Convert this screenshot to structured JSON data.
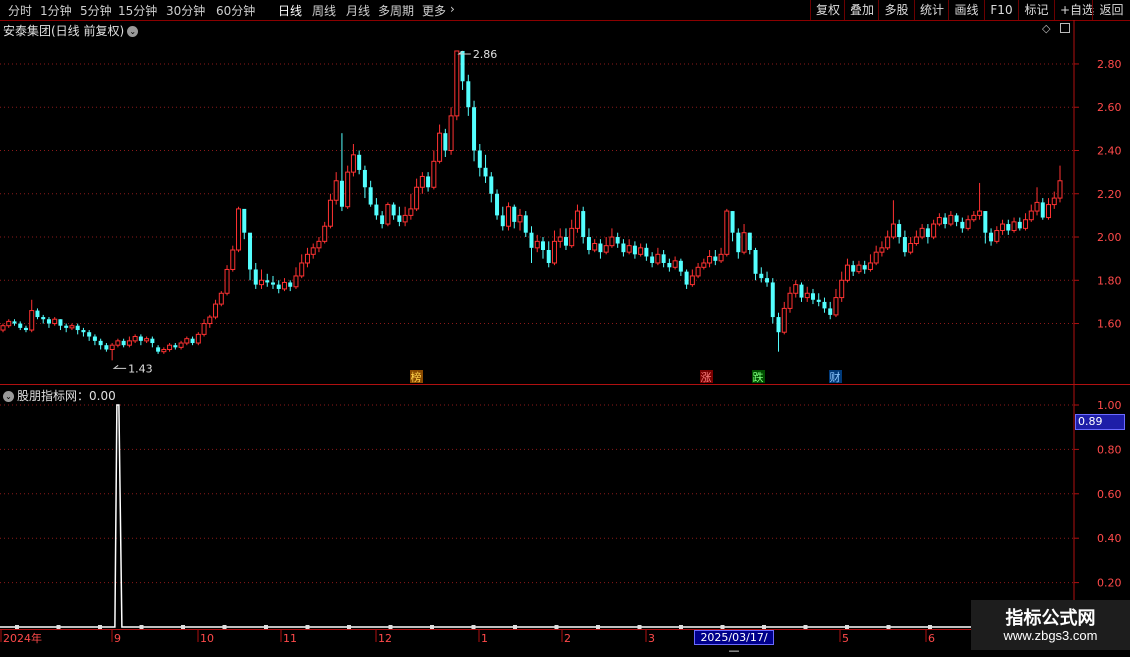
{
  "toolbar": {
    "periods": [
      "分时",
      "1分钟",
      "5分钟",
      "15分钟",
      "30分钟",
      "60分钟",
      "日线",
      "周线",
      "月线",
      "多周期",
      "更多"
    ],
    "active_period": "日线",
    "right_buttons": [
      "复权",
      "叠加",
      "多股",
      "统计",
      "画线",
      "F10",
      "标记",
      "+自选",
      "返回"
    ]
  },
  "main_panel": {
    "title": "安泰集团(日线 前复权)",
    "price_axis_ticks": [
      "2.80",
      "2.60",
      "2.40",
      "2.20",
      "2.00",
      "1.80",
      "1.60"
    ],
    "high_label": "2.86",
    "low_label": "1.43",
    "event_markers": [
      {
        "text": "榜",
        "bg": "#8a4a00",
        "fg": "#ffd24a"
      },
      {
        "text": "涨",
        "bg": "#7a0000",
        "fg": "#ff8080"
      },
      {
        "text": "跌",
        "bg": "#005000",
        "fg": "#7cff7c"
      },
      {
        "text": "财",
        "bg": "#003a7a",
        "fg": "#8ec8ff"
      }
    ]
  },
  "indicator_panel": {
    "title": "股朋指标网：0.00",
    "axis_ticks": [
      "1.00",
      "0.80",
      "0.60",
      "0.40",
      "0.20"
    ],
    "current_value": "0.89"
  },
  "time_axis": {
    "labels": [
      "2024年",
      "9",
      "10",
      "11",
      "12",
      "1",
      "2",
      "3",
      "5",
      "6"
    ],
    "cursor_date": "2025/03/17/—"
  },
  "watermark": {
    "line1": "指标公式网",
    "line2": "www.zbgs3.com"
  },
  "colors": {
    "up": "#ff3232",
    "down": "#54ffff",
    "grid": "#8b1a1a",
    "frame": "#b01010",
    "indicator_line": "#ffffff"
  },
  "chart_data": {
    "type": "candlestick",
    "ylim": [
      1.45,
      2.92
    ],
    "candles": [
      [
        1.57,
        1.59,
        1.56,
        1.6
      ],
      [
        1.59,
        1.61,
        1.58,
        1.62
      ],
      [
        1.61,
        1.6,
        1.59,
        1.62
      ],
      [
        1.6,
        1.58,
        1.57,
        1.61
      ],
      [
        1.58,
        1.57,
        1.56,
        1.59
      ],
      [
        1.57,
        1.66,
        1.56,
        1.71
      ],
      [
        1.66,
        1.63,
        1.62,
        1.67
      ],
      [
        1.63,
        1.62,
        1.6,
        1.64
      ],
      [
        1.62,
        1.6,
        1.58,
        1.63
      ],
      [
        1.6,
        1.62,
        1.59,
        1.63
      ],
      [
        1.62,
        1.59,
        1.57,
        1.62
      ],
      [
        1.59,
        1.58,
        1.56,
        1.6
      ],
      [
        1.58,
        1.59,
        1.57,
        1.6
      ],
      [
        1.59,
        1.57,
        1.55,
        1.6
      ],
      [
        1.57,
        1.56,
        1.54,
        1.58
      ],
      [
        1.56,
        1.54,
        1.52,
        1.57
      ],
      [
        1.54,
        1.52,
        1.5,
        1.55
      ],
      [
        1.52,
        1.5,
        1.48,
        1.53
      ],
      [
        1.5,
        1.48,
        1.47,
        1.51
      ],
      [
        1.48,
        1.5,
        1.43,
        1.51
      ],
      [
        1.5,
        1.52,
        1.49,
        1.53
      ],
      [
        1.52,
        1.5,
        1.49,
        1.53
      ],
      [
        1.5,
        1.52,
        1.49,
        1.54
      ],
      [
        1.52,
        1.54,
        1.51,
        1.55
      ],
      [
        1.54,
        1.52,
        1.5,
        1.55
      ],
      [
        1.52,
        1.53,
        1.51,
        1.54
      ],
      [
        1.53,
        1.51,
        1.49,
        1.54
      ],
      [
        1.49,
        1.47,
        1.46,
        1.5
      ],
      [
        1.47,
        1.48,
        1.46,
        1.49
      ],
      [
        1.48,
        1.5,
        1.47,
        1.51
      ],
      [
        1.5,
        1.49,
        1.48,
        1.51
      ],
      [
        1.49,
        1.51,
        1.48,
        1.52
      ],
      [
        1.51,
        1.53,
        1.5,
        1.54
      ],
      [
        1.53,
        1.51,
        1.5,
        1.54
      ],
      [
        1.51,
        1.55,
        1.5,
        1.56
      ],
      [
        1.55,
        1.6,
        1.54,
        1.62
      ],
      [
        1.6,
        1.63,
        1.58,
        1.64
      ],
      [
        1.63,
        1.69,
        1.62,
        1.71
      ],
      [
        1.69,
        1.74,
        1.68,
        1.75
      ],
      [
        1.74,
        1.85,
        1.73,
        1.87
      ],
      [
        1.85,
        1.94,
        1.84,
        1.96
      ],
      [
        1.94,
        2.13,
        1.93,
        2.14
      ],
      [
        2.13,
        2.02,
        1.99,
        2.08
      ],
      [
        2.02,
        1.85,
        1.8,
        1.94
      ],
      [
        1.85,
        1.78,
        1.76,
        1.88
      ],
      [
        1.78,
        1.8,
        1.76,
        1.85
      ],
      [
        1.8,
        1.79,
        1.77,
        1.83
      ],
      [
        1.79,
        1.78,
        1.76,
        1.82
      ],
      [
        1.78,
        1.76,
        1.74,
        1.8
      ],
      [
        1.76,
        1.79,
        1.75,
        1.81
      ],
      [
        1.79,
        1.77,
        1.75,
        1.8
      ],
      [
        1.77,
        1.82,
        1.76,
        1.86
      ],
      [
        1.82,
        1.88,
        1.81,
        1.92
      ],
      [
        1.88,
        1.92,
        1.86,
        1.95
      ],
      [
        1.92,
        1.95,
        1.9,
        1.97
      ],
      [
        1.95,
        1.98,
        1.93,
        2.0
      ],
      [
        1.98,
        2.05,
        1.97,
        2.07
      ],
      [
        2.05,
        2.17,
        2.04,
        2.2
      ],
      [
        2.17,
        2.26,
        2.15,
        2.3
      ],
      [
        2.26,
        2.14,
        2.12,
        2.48
      ],
      [
        2.14,
        2.3,
        2.13,
        2.33
      ],
      [
        2.3,
        2.38,
        2.28,
        2.43
      ],
      [
        2.38,
        2.31,
        2.29,
        2.4
      ],
      [
        2.31,
        2.23,
        2.18,
        2.33
      ],
      [
        2.23,
        2.15,
        2.14,
        2.26
      ],
      [
        2.15,
        2.1,
        2.08,
        2.18
      ],
      [
        2.1,
        2.06,
        2.04,
        2.12
      ],
      [
        2.06,
        2.15,
        2.05,
        2.16
      ],
      [
        2.15,
        2.1,
        2.08,
        2.16
      ],
      [
        2.1,
        2.07,
        2.05,
        2.14
      ],
      [
        2.07,
        2.1,
        2.05,
        2.14
      ],
      [
        2.1,
        2.13,
        2.08,
        2.2
      ],
      [
        2.13,
        2.23,
        2.12,
        2.27
      ],
      [
        2.23,
        2.28,
        2.2,
        2.3
      ],
      [
        2.28,
        2.23,
        2.21,
        2.3
      ],
      [
        2.23,
        2.35,
        2.22,
        2.4
      ],
      [
        2.35,
        2.48,
        2.34,
        2.52
      ],
      [
        2.48,
        2.4,
        2.37,
        2.5
      ],
      [
        2.4,
        2.56,
        2.38,
        2.6
      ],
      [
        2.56,
        2.86,
        2.54,
        2.86
      ],
      [
        2.86,
        2.72,
        2.68,
        2.82
      ],
      [
        2.72,
        2.6,
        2.56,
        2.75
      ],
      [
        2.6,
        2.4,
        2.35,
        2.63
      ],
      [
        2.4,
        2.32,
        2.28,
        2.43
      ],
      [
        2.32,
        2.28,
        2.25,
        2.38
      ],
      [
        2.28,
        2.2,
        2.16,
        2.3
      ],
      [
        2.2,
        2.1,
        2.08,
        2.22
      ],
      [
        2.1,
        2.05,
        2.03,
        2.14
      ],
      [
        2.05,
        2.14,
        2.03,
        2.16
      ],
      [
        2.14,
        2.07,
        2.04,
        2.15
      ],
      [
        2.07,
        2.1,
        2.03,
        2.13
      ],
      [
        2.1,
        2.02,
        2.0,
        2.12
      ],
      [
        2.02,
        1.95,
        1.88,
        2.05
      ],
      [
        1.95,
        1.98,
        1.93,
        2.01
      ],
      [
        1.98,
        1.94,
        1.9,
        2.0
      ],
      [
        1.94,
        1.88,
        1.86,
        1.98
      ],
      [
        1.88,
        1.98,
        1.87,
        2.03
      ],
      [
        1.98,
        2.0,
        1.95,
        2.04
      ],
      [
        2.0,
        1.96,
        1.94,
        2.04
      ],
      [
        1.96,
        2.04,
        1.95,
        2.08
      ],
      [
        2.04,
        2.12,
        2.02,
        2.15
      ],
      [
        2.12,
        2.0,
        1.97,
        2.14
      ],
      [
        2.0,
        1.94,
        1.92,
        2.04
      ],
      [
        1.94,
        1.97,
        1.93,
        1.99
      ],
      [
        1.97,
        1.93,
        1.9,
        1.99
      ],
      [
        1.93,
        1.96,
        1.92,
        2.0
      ],
      [
        1.96,
        2.0,
        1.95,
        2.04
      ],
      [
        2.0,
        1.97,
        1.95,
        2.02
      ],
      [
        1.97,
        1.93,
        1.91,
        1.99
      ],
      [
        1.93,
        1.96,
        1.92,
        1.99
      ],
      [
        1.96,
        1.92,
        1.9,
        1.98
      ],
      [
        1.92,
        1.95,
        1.91,
        1.97
      ],
      [
        1.95,
        1.91,
        1.89,
        1.97
      ],
      [
        1.91,
        1.88,
        1.86,
        1.93
      ],
      [
        1.88,
        1.92,
        1.87,
        1.95
      ],
      [
        1.92,
        1.88,
        1.86,
        1.94
      ],
      [
        1.88,
        1.86,
        1.84,
        1.9
      ],
      [
        1.86,
        1.89,
        1.85,
        1.91
      ],
      [
        1.89,
        1.84,
        1.82,
        1.9
      ],
      [
        1.84,
        1.78,
        1.76,
        1.85
      ],
      [
        1.78,
        1.82,
        1.77,
        1.85
      ],
      [
        1.82,
        1.86,
        1.81,
        1.88
      ],
      [
        1.86,
        1.88,
        1.85,
        1.9
      ],
      [
        1.88,
        1.91,
        1.86,
        1.94
      ],
      [
        1.91,
        1.89,
        1.87,
        1.94
      ],
      [
        1.89,
        1.92,
        1.88,
        1.95
      ],
      [
        1.92,
        2.12,
        1.91,
        2.13
      ],
      [
        2.12,
        2.02,
        1.98,
        2.12
      ],
      [
        2.02,
        1.93,
        1.9,
        2.04
      ],
      [
        1.93,
        2.02,
        1.92,
        2.06
      ],
      [
        2.02,
        1.94,
        1.92,
        2.02
      ],
      [
        1.94,
        1.83,
        1.8,
        1.95
      ],
      [
        1.83,
        1.81,
        1.79,
        1.86
      ],
      [
        1.81,
        1.79,
        1.77,
        1.84
      ],
      [
        1.79,
        1.63,
        1.6,
        1.81
      ],
      [
        1.63,
        1.56,
        1.47,
        1.65
      ],
      [
        1.56,
        1.67,
        1.55,
        1.7
      ],
      [
        1.67,
        1.74,
        1.65,
        1.77
      ],
      [
        1.74,
        1.78,
        1.72,
        1.8
      ],
      [
        1.78,
        1.72,
        1.7,
        1.79
      ],
      [
        1.72,
        1.74,
        1.7,
        1.77
      ],
      [
        1.74,
        1.71,
        1.69,
        1.76
      ],
      [
        1.71,
        1.7,
        1.68,
        1.74
      ],
      [
        1.7,
        1.67,
        1.65,
        1.72
      ],
      [
        1.67,
        1.64,
        1.62,
        1.7
      ],
      [
        1.64,
        1.72,
        1.63,
        1.76
      ],
      [
        1.72,
        1.8,
        1.7,
        1.84
      ],
      [
        1.8,
        1.87,
        1.79,
        1.9
      ],
      [
        1.87,
        1.84,
        1.82,
        1.89
      ],
      [
        1.84,
        1.87,
        1.83,
        1.89
      ],
      [
        1.87,
        1.85,
        1.83,
        1.89
      ],
      [
        1.85,
        1.88,
        1.84,
        1.92
      ],
      [
        1.88,
        1.93,
        1.87,
        1.96
      ],
      [
        1.93,
        1.95,
        1.91,
        1.98
      ],
      [
        1.95,
        2.0,
        1.94,
        2.03
      ],
      [
        2.0,
        2.06,
        1.99,
        2.17
      ],
      [
        2.06,
        2.0,
        1.97,
        2.08
      ],
      [
        2.0,
        1.93,
        1.91,
        2.03
      ],
      [
        1.93,
        1.97,
        1.92,
        2.0
      ],
      [
        1.97,
        2.0,
        1.96,
        2.03
      ],
      [
        2.0,
        2.04,
        1.99,
        2.06
      ],
      [
        2.04,
        2.0,
        1.97,
        2.06
      ],
      [
        2.0,
        2.06,
        1.99,
        2.08
      ],
      [
        2.06,
        2.09,
        2.05,
        2.11
      ],
      [
        2.09,
        2.06,
        2.04,
        2.11
      ],
      [
        2.06,
        2.1,
        2.05,
        2.12
      ],
      [
        2.1,
        2.07,
        2.05,
        2.11
      ],
      [
        2.07,
        2.04,
        2.02,
        2.09
      ],
      [
        2.04,
        2.08,
        2.03,
        2.1
      ],
      [
        2.08,
        2.1,
        2.07,
        2.12
      ],
      [
        2.1,
        2.12,
        2.08,
        2.25
      ],
      [
        2.12,
        2.02,
        1.97,
        2.12
      ],
      [
        2.02,
        1.98,
        1.96,
        2.04
      ],
      [
        1.98,
        2.03,
        1.97,
        2.05
      ],
      [
        2.03,
        2.06,
        2.01,
        2.08
      ],
      [
        2.06,
        2.03,
        2.01,
        2.08
      ],
      [
        2.03,
        2.07,
        2.02,
        2.09
      ],
      [
        2.07,
        2.04,
        2.03,
        2.09
      ],
      [
        2.04,
        2.08,
        2.03,
        2.11
      ],
      [
        2.08,
        2.12,
        2.07,
        2.15
      ],
      [
        2.12,
        2.16,
        2.1,
        2.23
      ],
      [
        2.16,
        2.09,
        2.08,
        2.18
      ],
      [
        2.09,
        2.15,
        2.08,
        2.18
      ],
      [
        2.15,
        2.18,
        2.13,
        2.21
      ],
      [
        2.18,
        2.26,
        2.16,
        2.33
      ]
    ],
    "indicator_series": {
      "name": "股朋指标网",
      "spike_index": 20,
      "spike_value": 1.0
    }
  }
}
